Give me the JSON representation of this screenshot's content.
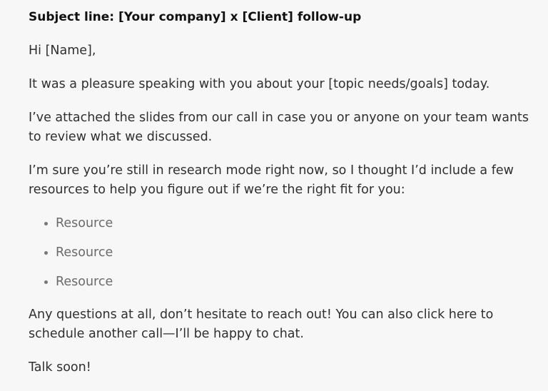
{
  "email": {
    "subject": "Subject line: [Your company] x [Client] follow-up",
    "greeting": "Hi [Name],",
    "paragraphs": [
      "It was a pleasure speaking with you about your [topic needs/goals] today.",
      "I’ve attached the slides from our call in case you or anyone on your team wants to review what we discussed.",
      "I’m sure you’re still in research mode right now, so I thought I’d include a few resources to help you figure out if we’re the right fit for you:"
    ],
    "resources": [
      "Resource",
      "Resource",
      "Resource"
    ],
    "closing_paragraph": "Any questions at all, don’t hesitate to reach out! You can also click here to schedule another call—I’ll be happy to chat.",
    "signoff": "Talk soon!"
  }
}
